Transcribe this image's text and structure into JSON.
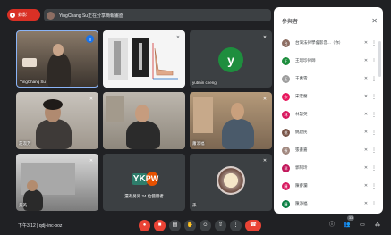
{
  "topbar": {
    "rec_label": "錄影",
    "presenter_label": "YingChang Su正在分享簡報畫面"
  },
  "tiles": [
    {
      "name": "YingChang Su",
      "mic": "active"
    },
    {
      "name": "",
      "mic": "muted"
    },
    {
      "name": "yutmin cheng",
      "avatar_letter": "y",
      "mic": "muted"
    },
    {
      "name": "莊淑芳",
      "mic": "muted"
    },
    {
      "name": "",
      "mic": "none"
    },
    {
      "name": "蕭添福",
      "mic": "muted"
    },
    {
      "name": "黃英",
      "mic": "muted"
    },
    {
      "name": "",
      "logo_left": "YK",
      "logo_right": "PW",
      "caption": "還有另外 24 位使用者",
      "mic": "none"
    },
    {
      "name": "孫",
      "mic": "muted"
    }
  ],
  "panel": {
    "title": "參與者",
    "close_icon": "close-icon",
    "participants": [
      {
        "name": "台灣法律學會影音...（你）",
        "color": "#8d6e63",
        "initial": "台"
      },
      {
        "name": "王瑞珍律師",
        "color": "#1e8e3e",
        "initial": "王"
      },
      {
        "name": "王惠雪",
        "color": "#9e9e9e",
        "initial": "王"
      },
      {
        "name": "宋宏蘭",
        "color": "#e8175d",
        "initial": "宋"
      },
      {
        "name": "林慧英",
        "color": "#d81b60",
        "initial": "林"
      },
      {
        "name": "姚啟民",
        "color": "#795548",
        "initial": "姚"
      },
      {
        "name": "張書嘉",
        "color": "#a1887f",
        "initial": "張"
      },
      {
        "name": "郭阿玲",
        "color": "#c2185b",
        "initial": "郭"
      },
      {
        "name": "陳睿瀾",
        "color": "#d81b60",
        "initial": "陳"
      },
      {
        "name": "陳添福",
        "color": "#0b8043",
        "initial": "陳"
      }
    ]
  },
  "bottombar": {
    "time": "下午3:12",
    "separator": "|",
    "meeting_code": "qdj-iinc-ooz",
    "participant_count": "33"
  },
  "colors": {
    "background": "#202124",
    "tile": "#3c4043",
    "accent_blue": "#1a73e8",
    "danger_red": "#ea4335"
  }
}
